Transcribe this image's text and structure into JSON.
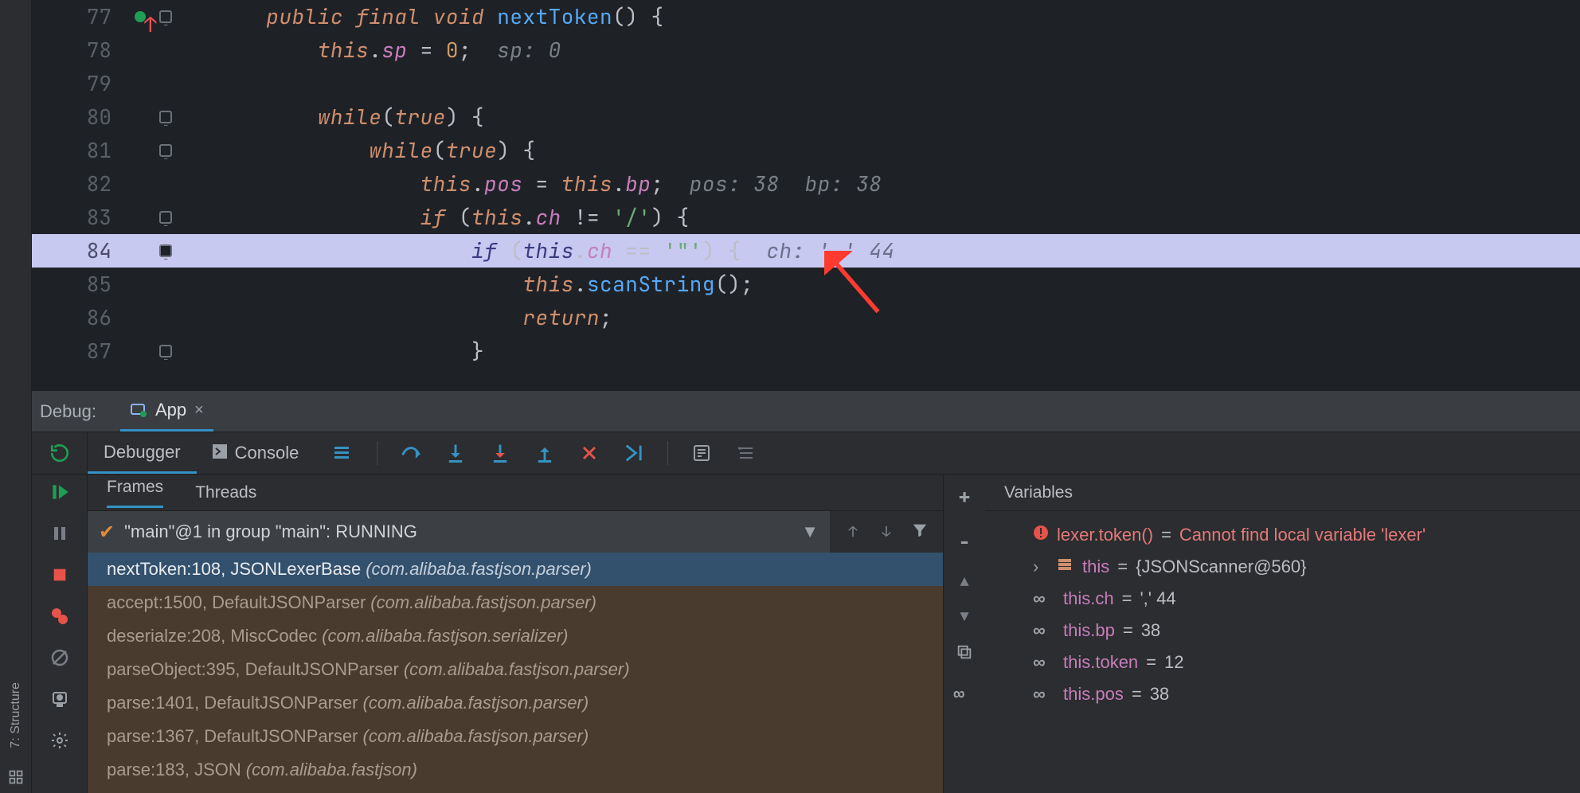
{
  "left_strip": {
    "structure_label": "7: Structure"
  },
  "editor": {
    "lines": [
      {
        "num": 77,
        "hasVcs": true,
        "fold": true,
        "tokens": [
          {
            "cls": "kw",
            "t": "public "
          },
          {
            "cls": "kw",
            "t": "final "
          },
          {
            "cls": "type",
            "t": "void "
          },
          {
            "cls": "mname",
            "t": "nextToken"
          },
          {
            "cls": "pn",
            "t": "() {"
          }
        ],
        "indent": 4
      },
      {
        "num": 78,
        "tokens": [
          {
            "cls": "kw2",
            "t": "this"
          },
          {
            "cls": "op",
            "t": "."
          },
          {
            "cls": "field",
            "t": "sp"
          },
          {
            "cls": "op",
            "t": " = "
          },
          {
            "cls": "num",
            "t": "0"
          },
          {
            "cls": "pn",
            "t": ";"
          }
        ],
        "hint": "  sp: 0",
        "indent": 8
      },
      {
        "num": 79,
        "tokens": [],
        "indent": 8
      },
      {
        "num": 80,
        "fold": true,
        "tokens": [
          {
            "cls": "kw2",
            "t": "while"
          },
          {
            "cls": "pn",
            "t": "("
          },
          {
            "cls": "kw2",
            "t": "true"
          },
          {
            "cls": "pn",
            "t": ") {"
          }
        ],
        "indent": 8
      },
      {
        "num": 81,
        "fold": true,
        "tokens": [
          {
            "cls": "kw2",
            "t": "while"
          },
          {
            "cls": "pn",
            "t": "("
          },
          {
            "cls": "kw2",
            "t": "true"
          },
          {
            "cls": "pn",
            "t": ") {"
          }
        ],
        "indent": 12
      },
      {
        "num": 82,
        "tokens": [
          {
            "cls": "kw2",
            "t": "this"
          },
          {
            "cls": "op",
            "t": "."
          },
          {
            "cls": "field",
            "t": "pos"
          },
          {
            "cls": "op",
            "t": " = "
          },
          {
            "cls": "kw2",
            "t": "this"
          },
          {
            "cls": "op",
            "t": "."
          },
          {
            "cls": "field",
            "t": "bp"
          },
          {
            "cls": "pn",
            "t": ";"
          }
        ],
        "hint": "  pos: 38  bp: 38",
        "indent": 16
      },
      {
        "num": 83,
        "fold": true,
        "tokens": [
          {
            "cls": "kw2",
            "t": "if "
          },
          {
            "cls": "pn",
            "t": "("
          },
          {
            "cls": "kw2",
            "t": "this"
          },
          {
            "cls": "op",
            "t": "."
          },
          {
            "cls": "field",
            "t": "ch"
          },
          {
            "cls": "op",
            "t": " != "
          },
          {
            "cls": "str",
            "t": "'/'"
          },
          {
            "cls": "pn",
            "t": ") {"
          }
        ],
        "indent": 16
      },
      {
        "num": 84,
        "hl": true,
        "fold": true,
        "tokens": [
          {
            "cls": "kw",
            "t": "if "
          },
          {
            "cls": "pn",
            "t": "("
          },
          {
            "cls": "kw",
            "t": "this"
          },
          {
            "cls": "op",
            "t": "."
          },
          {
            "cls": "field",
            "t": "ch"
          },
          {
            "cls": "op",
            "t": " == "
          },
          {
            "cls": "str",
            "t": "'\"'"
          },
          {
            "cls": "pn",
            "t": ") {"
          }
        ],
        "hint": "  ch: ',' 44",
        "indent": 20
      },
      {
        "num": 85,
        "tokens": [
          {
            "cls": "kw2",
            "t": "this"
          },
          {
            "cls": "op",
            "t": "."
          },
          {
            "cls": "mname",
            "t": "scanString"
          },
          {
            "cls": "pn",
            "t": "();"
          }
        ],
        "indent": 24
      },
      {
        "num": 86,
        "tokens": [
          {
            "cls": "kw2",
            "t": "return"
          },
          {
            "cls": "pn",
            "t": ";"
          }
        ],
        "indent": 24
      },
      {
        "num": 87,
        "fold": true,
        "tokens": [
          {
            "cls": "pn",
            "t": "}"
          }
        ],
        "indent": 20
      }
    ]
  },
  "debug_strip": {
    "label": "Debug:",
    "tab_name": "App"
  },
  "dbg_toolbar": {
    "tabs": [
      "Debugger",
      "Console"
    ]
  },
  "frames": {
    "tabs": [
      "Frames",
      "Threads"
    ],
    "thread": "\"main\"@1 in group \"main\": RUNNING",
    "items": [
      {
        "title": "nextToken:108, JSONLexerBase",
        "pkg": "(com.alibaba.fastjson.parser)",
        "active": true
      },
      {
        "title": "accept:1500, DefaultJSONParser",
        "pkg": "(com.alibaba.fastjson.parser)"
      },
      {
        "title": "deserialze:208, MiscCodec",
        "pkg": "(com.alibaba.fastjson.serializer)"
      },
      {
        "title": "parseObject:395, DefaultJSONParser",
        "pkg": "(com.alibaba.fastjson.parser)"
      },
      {
        "title": "parse:1401, DefaultJSONParser",
        "pkg": "(com.alibaba.fastjson.parser)"
      },
      {
        "title": "parse:1367, DefaultJSONParser",
        "pkg": "(com.alibaba.fastjson.parser)"
      },
      {
        "title": "parse:183, JSON",
        "pkg": "(com.alibaba.fastjson)"
      }
    ]
  },
  "variables": {
    "header": "Variables",
    "rows": [
      {
        "kind": "error",
        "name": "lexer.token()",
        "val": "Cannot find local variable 'lexer'"
      },
      {
        "kind": "obj",
        "exp": true,
        "name": "this",
        "val": "{JSONScanner@560}"
      },
      {
        "kind": "watch",
        "name": "this.ch",
        "val": "',' 44"
      },
      {
        "kind": "watch",
        "name": "this.bp",
        "val": "38"
      },
      {
        "kind": "watch",
        "name": "this.token",
        "val": "12"
      },
      {
        "kind": "watch",
        "name": "this.pos",
        "val": "38"
      }
    ]
  }
}
